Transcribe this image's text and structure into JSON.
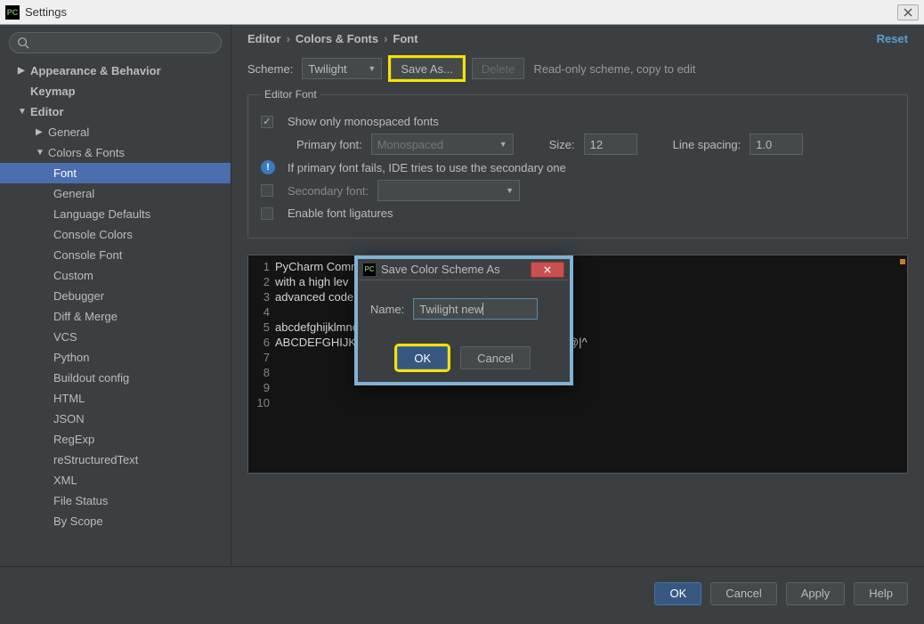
{
  "window": {
    "title": "Settings"
  },
  "breadcrumb": {
    "a": "Editor",
    "b": "Colors & Fonts",
    "c": "Font"
  },
  "reset_label": "Reset",
  "scheme": {
    "label": "Scheme:",
    "value": "Twilight",
    "save_as": "Save As...",
    "delete": "Delete",
    "readonly_note": "Read-only scheme, copy to edit"
  },
  "editor_font": {
    "legend": "Editor Font",
    "show_mono": "Show only monospaced fonts",
    "primary_label": "Primary font:",
    "primary_value": "Monospaced",
    "size_label": "Size:",
    "size_value": "12",
    "spacing_label": "Line spacing:",
    "spacing_value": "1.0",
    "fallback_note": "If primary font fails, IDE tries to use the secondary one",
    "secondary_label": "Secondary font:",
    "ligatures_label": "Enable font ligatures"
  },
  "tree": {
    "appearance": "Appearance & Behavior",
    "keymap": "Keymap",
    "editor": "Editor",
    "general": "General",
    "colors_fonts": "Colors & Fonts",
    "items": [
      "Font",
      "General",
      "Language Defaults",
      "Console Colors",
      "Console Font",
      "Custom",
      "Debugger",
      "Diff & Merge",
      "VCS",
      "Python",
      "Buildout config",
      "HTML",
      "JSON",
      "RegExp",
      "reStructuredText",
      "XML",
      "File Status",
      "By Scope"
    ]
  },
  "preview": {
    "lines": [
      "PyCharm Communi",
      "with a high lev",
      "advanced code e",
      "",
      "abcdefghijklmnopqrstuvwxyz 0123456789 (){}[]",
      "ABCDEFGHIJKLMNOPQRSTUVWXYZ +-*/= .,;:!? #&$%@|^",
      "",
      "",
      "",
      ""
    ]
  },
  "dialog": {
    "title": "Save Color Scheme As",
    "name_label": "Name:",
    "name_value": "Twilight new",
    "ok": "OK",
    "cancel": "Cancel"
  },
  "footer": {
    "ok": "OK",
    "cancel": "Cancel",
    "apply": "Apply",
    "help": "Help"
  }
}
